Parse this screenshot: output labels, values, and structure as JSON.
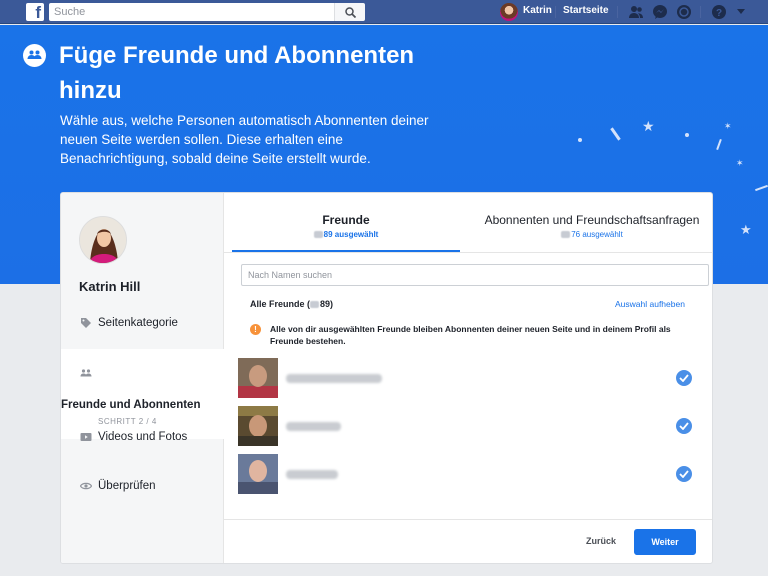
{
  "topbar": {
    "logo": "f",
    "search_placeholder": "Suche",
    "user_name": "Katrin",
    "home_label": "Startseite",
    "icons": [
      "friends-icon",
      "messenger-icon",
      "notifications-icon",
      "help-icon",
      "menu-caret-icon"
    ]
  },
  "hero": {
    "title": "Füge Freunde und Abonnenten hinzu",
    "description": "Wähle aus, welche Personen automatisch Abonnenten deiner neuen Seite werden sollen. Diese erhalten eine Benachrichtigung, sobald deine Seite erstellt wurde."
  },
  "sidebar": {
    "profile_name": "Katrin Hill",
    "steps": [
      {
        "label": "Seitenkategorie",
        "icon": "tag-icon"
      },
      {
        "label": "Freunde und Abonnenten",
        "icon": "people-icon",
        "step_counter": "SCHRITT 2 / 4"
      },
      {
        "label": "Videos und Fotos",
        "icon": "video-icon"
      },
      {
        "label": "Überprüfen",
        "icon": "eye-icon"
      }
    ]
  },
  "tabs": [
    {
      "label": "Freunde",
      "count_suffix": "89 ausgewählt"
    },
    {
      "label": "Abonnenten und Freundschaftsanfragen",
      "count_suffix": "76 ausgewählt"
    }
  ],
  "main": {
    "search_placeholder": "Nach Namen suchen",
    "all_friends_prefix": "Alle Freunde (",
    "all_friends_suffix": "89)",
    "deselect_label": "Auswahl aufheben",
    "info_text": "Alle von dir ausgewählten Freunde bleiben Abonnenten deiner neuen Seite und in deinem Profil als Freunde bestehen.",
    "friends_selected": [
      true,
      true,
      true
    ]
  },
  "footer": {
    "back_label": "Zurück",
    "next_label": "Weiter"
  },
  "colors": {
    "topbar": "#3b5998",
    "hero": "#1a73e8",
    "accent": "#1a73e8",
    "info": "#f7923a"
  }
}
